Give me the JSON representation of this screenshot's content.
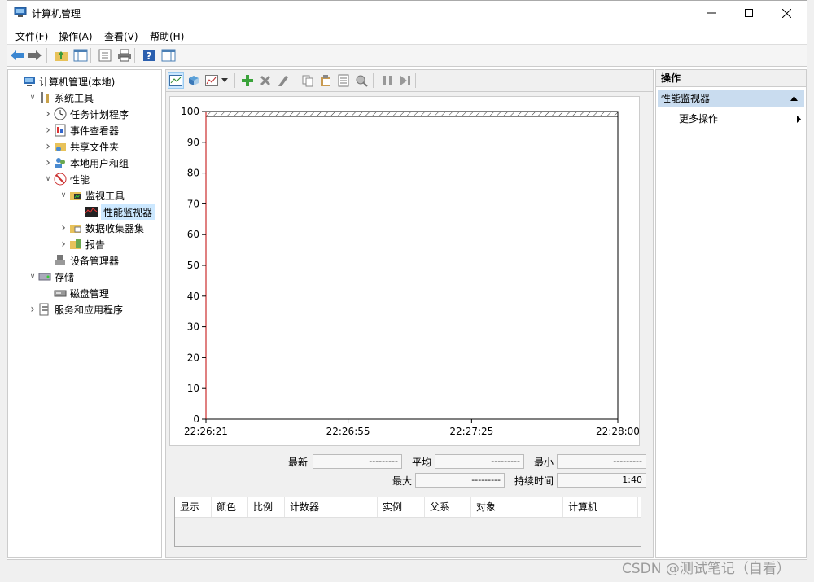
{
  "window": {
    "title": "计算机管理"
  },
  "menu": [
    "文件(F)",
    "操作(A)",
    "查看(V)",
    "帮助(H)"
  ],
  "tree": [
    {
      "label": "计算机管理(本地)",
      "level": 0,
      "expanded": null,
      "icon": "computer-management-icon"
    },
    {
      "label": "系统工具",
      "level": 1,
      "expanded": true,
      "icon": "system-tools-icon"
    },
    {
      "label": "任务计划程序",
      "level": 2,
      "expanded": false,
      "icon": "task-scheduler-icon"
    },
    {
      "label": "事件查看器",
      "level": 2,
      "expanded": false,
      "icon": "event-viewer-icon"
    },
    {
      "label": "共享文件夹",
      "level": 2,
      "expanded": false,
      "icon": "shared-folders-icon"
    },
    {
      "label": "本地用户和组",
      "level": 2,
      "expanded": false,
      "icon": "local-users-icon"
    },
    {
      "label": "性能",
      "level": 2,
      "expanded": true,
      "icon": "performance-icon"
    },
    {
      "label": "监视工具",
      "level": 3,
      "expanded": true,
      "icon": "monitoring-tools-icon"
    },
    {
      "label": "性能监视器",
      "level": 4,
      "expanded": null,
      "icon": "perf-monitor-icon",
      "selected": true
    },
    {
      "label": "数据收集器集",
      "level": 3,
      "expanded": false,
      "icon": "data-collector-icon"
    },
    {
      "label": "报告",
      "level": 3,
      "expanded": false,
      "icon": "reports-icon"
    },
    {
      "label": "设备管理器",
      "level": 2,
      "expanded": null,
      "icon": "device-manager-icon"
    },
    {
      "label": "存储",
      "level": 1,
      "expanded": true,
      "icon": "storage-icon"
    },
    {
      "label": "磁盘管理",
      "level": 2,
      "expanded": null,
      "icon": "disk-management-icon"
    },
    {
      "label": "服务和应用程序",
      "level": 1,
      "expanded": false,
      "icon": "services-apps-icon"
    }
  ],
  "stats": {
    "last_label": "最新",
    "last_value": "---------",
    "avg_label": "平均",
    "avg_value": "---------",
    "min_label": "最小",
    "min_value": "---------",
    "max_label": "最大",
    "max_value": "---------",
    "duration_label": "持续时间",
    "duration_value": "1:40"
  },
  "counter_columns": [
    "显示",
    "颜色",
    "比例",
    "计数器",
    "实例",
    "父系",
    "对象",
    "计算机"
  ],
  "actions": {
    "header": "操作",
    "section": "性能监视器",
    "more": "更多操作"
  },
  "chart_data": {
    "type": "line",
    "ylim": [
      0,
      100
    ],
    "y_ticks": [
      "0",
      "10",
      "20",
      "30",
      "40",
      "50",
      "60",
      "70",
      "80",
      "90",
      "100"
    ],
    "x_tick_labels": [
      "22:26:21",
      "22:26:55",
      "22:27:25",
      "22:28:00"
    ],
    "x_tick_fractions": [
      0,
      0.345,
      0.645,
      1
    ],
    "series": []
  },
  "watermark": "CSDN @测试笔记（自看）"
}
